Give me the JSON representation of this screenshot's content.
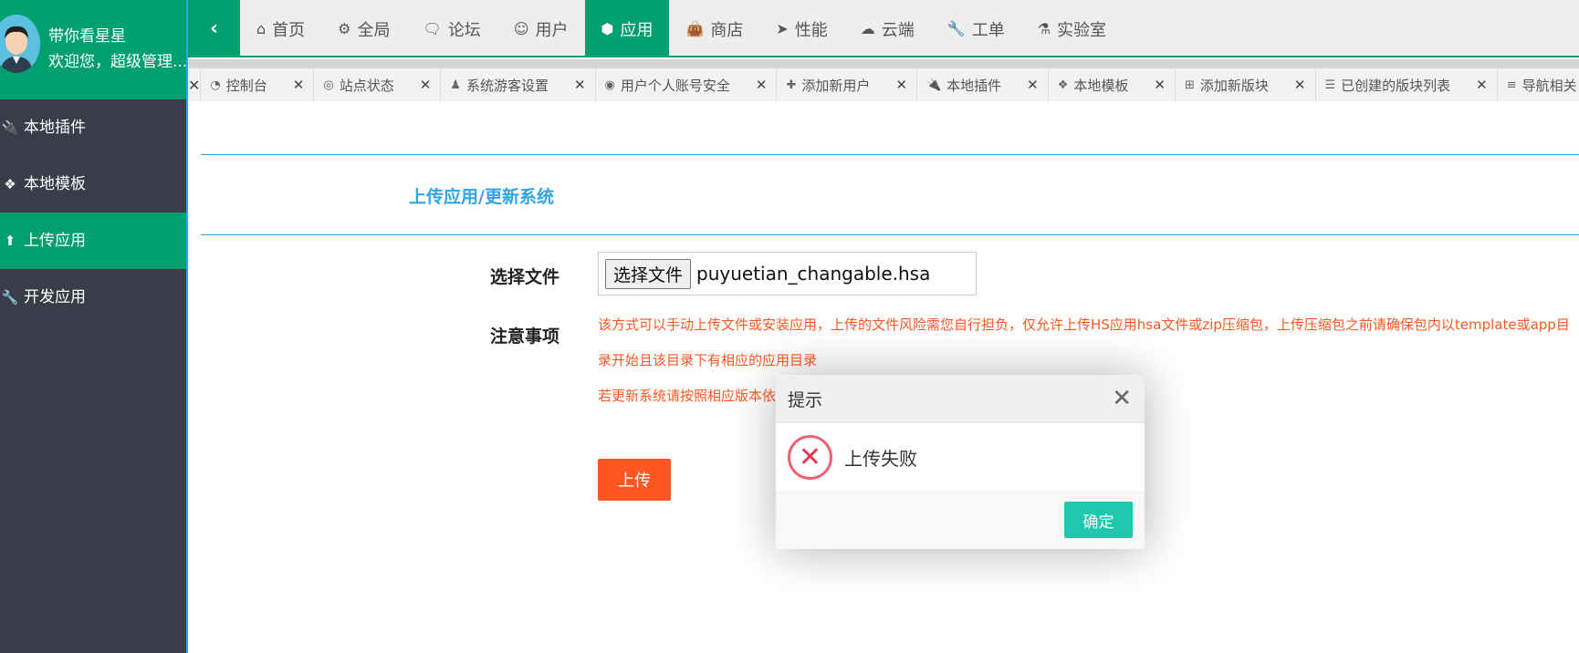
{
  "user": {
    "name": "带你看星星",
    "welcome": "欢迎您，超级管理..."
  },
  "sidebar": {
    "items": [
      {
        "label": "本地插件",
        "icon": "plug-icon"
      },
      {
        "label": "本地模板",
        "icon": "puzzle-icon"
      },
      {
        "label": "上传应用",
        "icon": "upload-icon",
        "active": true
      },
      {
        "label": "开发应用",
        "icon": "wrench-icon"
      }
    ]
  },
  "topnav": {
    "items": [
      {
        "label": "首页",
        "icon": "home-icon"
      },
      {
        "label": "全局",
        "icon": "gears-icon"
      },
      {
        "label": "论坛",
        "icon": "comments-icon"
      },
      {
        "label": "用户",
        "icon": "users-icon"
      },
      {
        "label": "应用",
        "icon": "cubes-icon",
        "active": true
      },
      {
        "label": "商店",
        "icon": "shopping-bag-icon"
      },
      {
        "label": "性能",
        "icon": "paper-plane-icon"
      },
      {
        "label": "云端",
        "icon": "cloud-icon"
      },
      {
        "label": "工单",
        "icon": "wrench-icon"
      },
      {
        "label": "实验室",
        "icon": "flask-icon"
      }
    ]
  },
  "tabs": [
    {
      "label": "控制台",
      "icon": "dashboard-icon"
    },
    {
      "label": "站点状态",
      "icon": "status-icon"
    },
    {
      "label": "系统游客设置",
      "icon": "user-secret-icon"
    },
    {
      "label": "用户个人账号安全",
      "icon": "user-circle-icon"
    },
    {
      "label": "添加新用户",
      "icon": "user-plus-icon"
    },
    {
      "label": "本地插件",
      "icon": "plug-icon"
    },
    {
      "label": "本地模板",
      "icon": "puzzle-icon"
    },
    {
      "label": "添加新版块",
      "icon": "plus-square-icon"
    },
    {
      "label": "已创建的版块列表",
      "icon": "list-icon"
    },
    {
      "label": "导航相关",
      "icon": "bars-icon"
    }
  ],
  "main": {
    "section_title": "上传应用/更新系统",
    "file_label": "选择文件",
    "file_button": "选择文件",
    "file_name": "puyuetian_changable.hsa",
    "notice_label": "注意事项",
    "notice_line1": "该方式可以手动上传文件或安装应用，上传的文件风险需您自行担负，仅允许上传HS应用hsa文件或zip压缩包，上传压缩包之前请确保包内以template或app目",
    "notice_line2": "录开始且该目录下有相应的应用目录",
    "notice_line3": "若更新系统请按照相应版本依",
    "upload_button": "上传"
  },
  "dialog": {
    "title": "提示",
    "message": "上传失败",
    "ok_button": "确定"
  },
  "colors": {
    "green": "#009f6f",
    "blue": "#2fa4e7",
    "orange": "#ff5722",
    "teal": "#1fc7ac",
    "sidebar": "#393d49"
  }
}
